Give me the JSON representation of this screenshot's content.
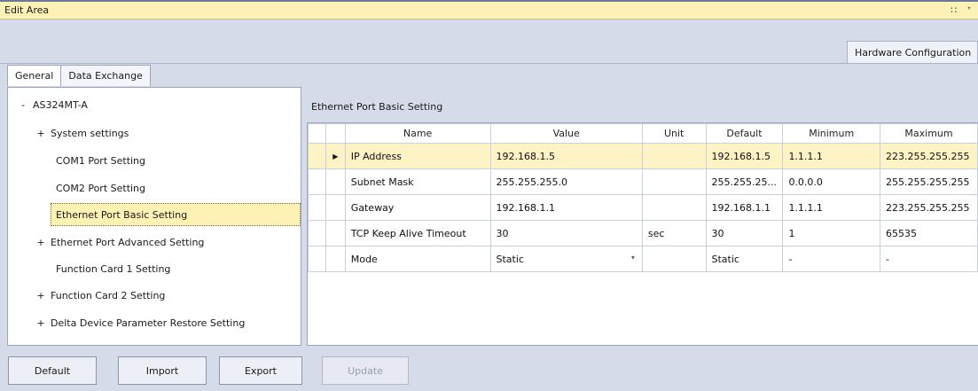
{
  "window": {
    "title": "Edit Area",
    "pin_glyph": "∷  "
  },
  "doc_tabs": [
    "Hardware Configuration"
  ],
  "sub_tabs": [
    "General",
    "Data Exchange"
  ],
  "tree": {
    "root": {
      "expander": "-",
      "label": "AS324MT-A"
    },
    "items": [
      {
        "expander": "+",
        "label": "System settings"
      },
      {
        "expander": "",
        "label": "COM1 Port Setting"
      },
      {
        "expander": "",
        "label": "COM2 Port Setting"
      },
      {
        "expander": "",
        "label": "Ethernet Port Basic Setting",
        "selected": true
      },
      {
        "expander": "+",
        "label": "Ethernet Port Advanced Setting"
      },
      {
        "expander": "",
        "label": "Function Card 1 Setting"
      },
      {
        "expander": "+",
        "label": "Function Card 2 Setting"
      },
      {
        "expander": "+",
        "label": "Delta Device Parameter Restore Setting"
      }
    ]
  },
  "panel_title": "Ethernet Port Basic Setting",
  "grid": {
    "columns": [
      "Name",
      "Value",
      "Unit",
      "Default",
      "Minimum",
      "Maximum"
    ],
    "row_indicator": "▶",
    "rows": [
      {
        "name": "IP Address",
        "value": "192.168.1.5",
        "unit": "",
        "default": "192.168.1.5",
        "minimum": "1.1.1.1",
        "maximum": "223.255.255.255",
        "selected": true
      },
      {
        "name": "Subnet Mask",
        "value": "255.255.255.0",
        "unit": "",
        "default": "255.255.25...",
        "minimum": "0.0.0.0",
        "maximum": "255.255.255.255"
      },
      {
        "name": "Gateway",
        "value": "192.168.1.1",
        "unit": "",
        "default": "192.168.1.1",
        "minimum": "1.1.1.1",
        "maximum": "223.255.255.255"
      },
      {
        "name": "TCP Keep Alive Timeout",
        "value": "30",
        "unit": "sec",
        "default": "30",
        "minimum": "1",
        "maximum": "65535"
      },
      {
        "name": "Mode",
        "value": "Static",
        "unit": "",
        "default": "Static",
        "minimum": "-",
        "maximum": "-",
        "dropdown": "▾"
      }
    ]
  },
  "buttons": {
    "default": "Default",
    "import": "Import",
    "export": "Export",
    "update": "Update"
  },
  "colors": {
    "title_bar": "#fdf2b6",
    "selection": "#fdf1b4",
    "background": "#d6dbe9"
  }
}
